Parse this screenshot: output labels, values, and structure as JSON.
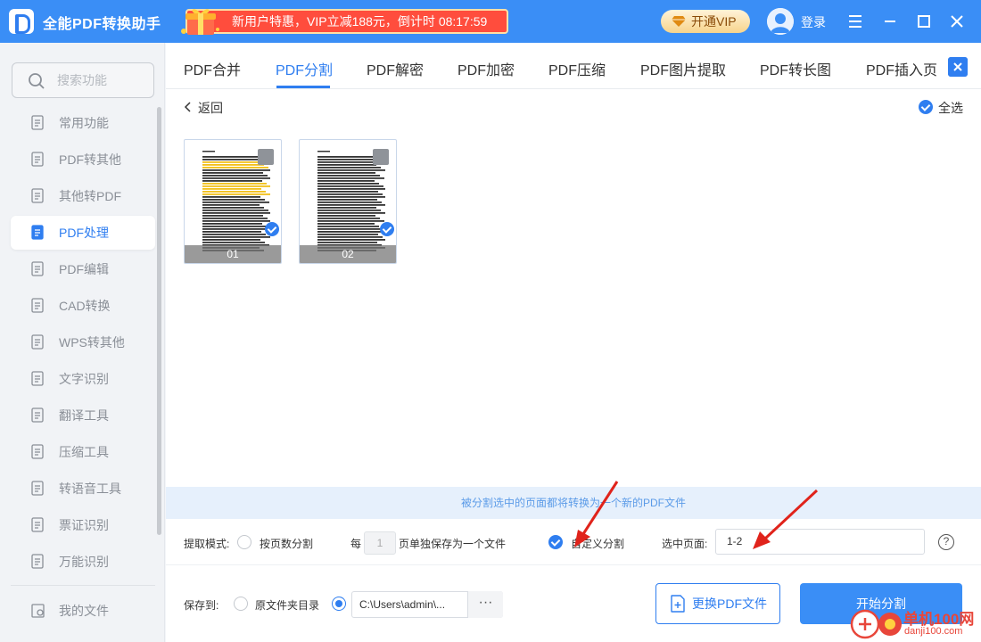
{
  "titlebar": {
    "app_title": "全能PDF转换助手",
    "promo": "新用户特惠，VIP立减188元，倒计时 08:17:59",
    "vip_label": "开通VIP",
    "login_label": "登录"
  },
  "sidebar": {
    "search_placeholder": "搜索功能",
    "items": [
      {
        "label": "常用功能",
        "icon": "star-doc-icon"
      },
      {
        "label": "PDF转其他",
        "icon": "pdf-export-icon"
      },
      {
        "label": "其他转PDF",
        "icon": "pdf-import-icon"
      },
      {
        "label": "PDF处理",
        "icon": "pdf-process-icon"
      },
      {
        "label": "PDF编辑",
        "icon": "pdf-edit-icon"
      },
      {
        "label": "CAD转换",
        "icon": "cad-icon"
      },
      {
        "label": "WPS转其他",
        "icon": "wps-icon"
      },
      {
        "label": "文字识别",
        "icon": "ocr-icon"
      },
      {
        "label": "翻译工具",
        "icon": "translate-icon"
      },
      {
        "label": "压缩工具",
        "icon": "zip-icon"
      },
      {
        "label": "转语音工具",
        "icon": "audio-icon"
      },
      {
        "label": "票证识别",
        "icon": "ticket-icon"
      },
      {
        "label": "万能识别",
        "icon": "camera-icon"
      }
    ],
    "my_files": "我的文件",
    "active_index": 3
  },
  "tabs": [
    {
      "label": "PDF合并"
    },
    {
      "label": "PDF分割"
    },
    {
      "label": "PDF解密"
    },
    {
      "label": "PDF加密"
    },
    {
      "label": "PDF压缩"
    },
    {
      "label": "PDF图片提取"
    },
    {
      "label": "PDF转长图"
    },
    {
      "label": "PDF插入页"
    }
  ],
  "main": {
    "back_label": "返回",
    "select_all_label": "全选",
    "pages": [
      {
        "label": "01",
        "checked": true
      },
      {
        "label": "02",
        "checked": true
      }
    ]
  },
  "info_bar": "被分割选中的页面都将转换为一个新的PDF文件",
  "options": {
    "mode_label": "提取模式:",
    "by_page_label": "按页数分割",
    "every_label": "每",
    "every_value": "1",
    "per_page_label": "页单独保存为一个文件",
    "custom_label": "自定义分割",
    "selected_pages_label": "选中页面:",
    "selected_pages_value": "1-2",
    "help": "?"
  },
  "bottom": {
    "save_to_label": "保存到:",
    "original_folder_label": "原文件夹目录",
    "path_value": "C:\\Users\\admin\\...",
    "more": "···",
    "change_pdf_label": "更换PDF文件",
    "start_label": "开始分割"
  },
  "watermark": {
    "text": "单机100网",
    "url": "danji100.com"
  },
  "colors": {
    "accent": "#2f7ef0",
    "titlebar": "#3a8ef6",
    "promo": "#ff4d3d",
    "arrow": "#e0231b"
  }
}
